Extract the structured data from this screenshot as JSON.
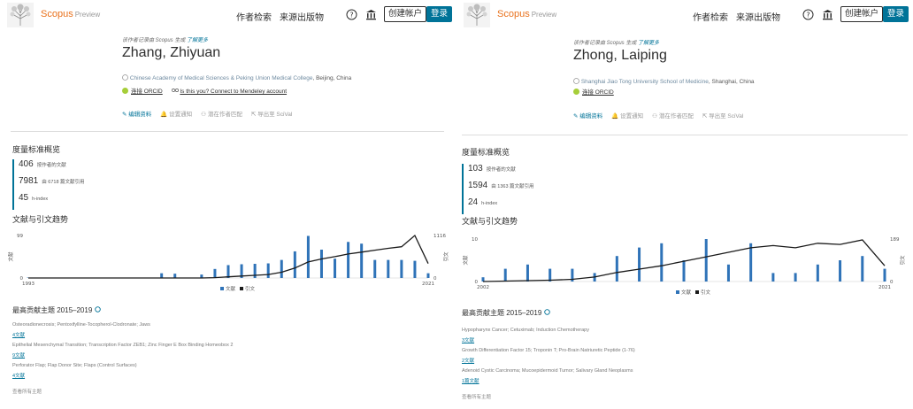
{
  "header": {
    "brand": "Scopus",
    "brand_suffix": "Preview",
    "nav_author_search": "作者检索",
    "nav_sources": "来源出版物",
    "create_account": "创建帐户",
    "login": "登录"
  },
  "profiles": [
    {
      "notice_prefix": "该作者记录由 Scopus 生成",
      "notice_link": "了解更多",
      "name": "Zhang, Zhiyuan",
      "affiliation_org": "Chinese Academy of Medical Sciences & Peking Union Medical College",
      "affiliation_loc": ", Beijing, China",
      "orcid_label": "连接 ORCID",
      "mendeley_label": "Is this you? Connect to Mendeley account",
      "actions": [
        "编辑资料",
        "设置通知",
        "潜在作者匹配",
        "导出至 SciVal"
      ],
      "metrics_title": "度量标准概览",
      "metrics": [
        {
          "value": "406",
          "label": "按作者的文献"
        },
        {
          "value": "7981",
          "label": "由 6718 篇文献引用"
        },
        {
          "value": "45",
          "label": "h-index"
        }
      ],
      "trends_title": "文献与引文趋势",
      "topics_title": "最高贡献主题 2015–2019",
      "topics": [
        {
          "name": "Osteoradionecrosis; Pentoxifylline-Tocopherol-Clodronate; Jaws",
          "docs": "4文献"
        },
        {
          "name": "Epithelial Mesenchymal Transition; Transcription Factor ZEB1; Zinc Finger E Box Binding Homeobox 2",
          "docs": "9文献"
        },
        {
          "name": "Perforator Flap; Flap Donor Site; Flaps (Control Surfaces)",
          "docs": "4文献"
        }
      ],
      "view_all": "查看所有主题"
    },
    {
      "notice_prefix": "该作者记录由 Scopus 生成",
      "notice_link": "了解更多",
      "name": "Zhong, Laiping",
      "affiliation_org": "Shanghai Jiao Tong University School of Medicine",
      "affiliation_loc": ", Shanghai, China",
      "orcid_label": "连接 ORCID",
      "mendeley_label": "",
      "actions": [
        "编辑资料",
        "设置通知",
        "潜在作者匹配",
        "导出至 SciVal"
      ],
      "metrics_title": "度量标准概览",
      "metrics": [
        {
          "value": "103",
          "label": "按作者的文献"
        },
        {
          "value": "1594",
          "label": "由 1363 篇文献引用"
        },
        {
          "value": "24",
          "label": "h-index"
        }
      ],
      "trends_title": "文献与引文趋势",
      "topics_title": "最高贡献主题 2015–2019",
      "topics": [
        {
          "name": "Hypopharynx Cancer; Cetuximab; Induction Chemotherapy",
          "docs": "3文献"
        },
        {
          "name": "Growth Differentiation Factor 15; Troponin T; Pro-Brain Natriuretic Peptide (1-76)",
          "docs": "2文献"
        },
        {
          "name": "Adenoid Cystic Carcinoma; Mucoepidermoid Tumor; Salivary Gland Neoplasms",
          "docs": "1篇文献"
        }
      ],
      "view_all": "查看所有主题"
    }
  ],
  "chart_data": [
    {
      "type": "bar",
      "x_start": 1993,
      "x_end": 2021,
      "y_left_max": 99,
      "y_right_max": 1116,
      "y_left_label": "文献",
      "y_right_label": "引文",
      "series": [
        {
          "name": "文献",
          "axis": "left",
          "color": "#2f73b8",
          "values": [
            1,
            0,
            0,
            0,
            0,
            0,
            0,
            0,
            0,
            0,
            11,
            10,
            0,
            8,
            21,
            30,
            32,
            33,
            34,
            42,
            62,
            98,
            66,
            45,
            84,
            80,
            42,
            42,
            42,
            40,
            11
          ]
        },
        {
          "name": "引文",
          "axis": "right",
          "color": "#1a1a1a",
          "values": [
            0,
            0,
            0,
            0,
            0,
            0,
            0,
            0,
            0,
            0,
            0,
            0,
            0,
            0,
            10,
            30,
            50,
            70,
            90,
            150,
            260,
            420,
            500,
            560,
            630,
            680,
            730,
            780,
            820,
            1116,
            380
          ]
        }
      ]
    },
    {
      "type": "bar",
      "x_start": 2002,
      "x_end": 2021,
      "y_left_max": 10,
      "y_right_max": 189,
      "y_left_label": "文献",
      "y_right_label": "引文",
      "series": [
        {
          "name": "文献",
          "axis": "left",
          "color": "#2f73b8",
          "values": [
            1,
            3,
            4,
            3,
            3,
            2,
            6,
            8,
            9,
            5,
            10,
            4,
            9,
            2,
            2,
            4,
            5,
            6,
            3
          ]
        },
        {
          "name": "引文",
          "axis": "right",
          "color": "#1a1a1a",
          "values": [
            0,
            2,
            4,
            6,
            10,
            20,
            40,
            55,
            70,
            90,
            110,
            130,
            150,
            160,
            150,
            170,
            165,
            185,
            70
          ]
        }
      ]
    }
  ]
}
